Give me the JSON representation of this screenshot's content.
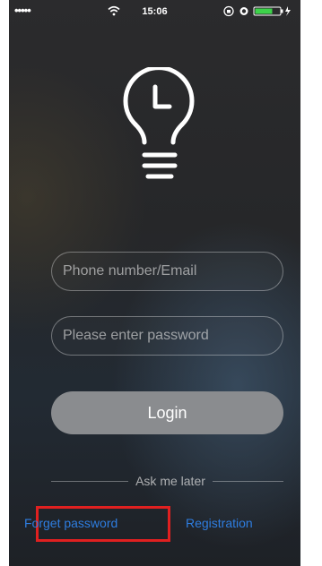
{
  "status_bar": {
    "signal": "•••••",
    "time": "15:06"
  },
  "login_form": {
    "phone_placeholder": "Phone number/Email",
    "password_placeholder": "Please enter password",
    "login_label": "Login"
  },
  "ask_later": "Ask me later",
  "links": {
    "forget_password": "Forget password",
    "registration": "Registration"
  },
  "colors": {
    "link": "#2e7de0",
    "highlight_box": "#e02020",
    "login_button": "#8a8c8f"
  },
  "icons": [
    "signal-dots-icon",
    "wifi-icon",
    "lock-rotation-icon",
    "alarm-icon",
    "battery-icon",
    "charging-icon",
    "bulb-clock-logo-icon"
  ]
}
